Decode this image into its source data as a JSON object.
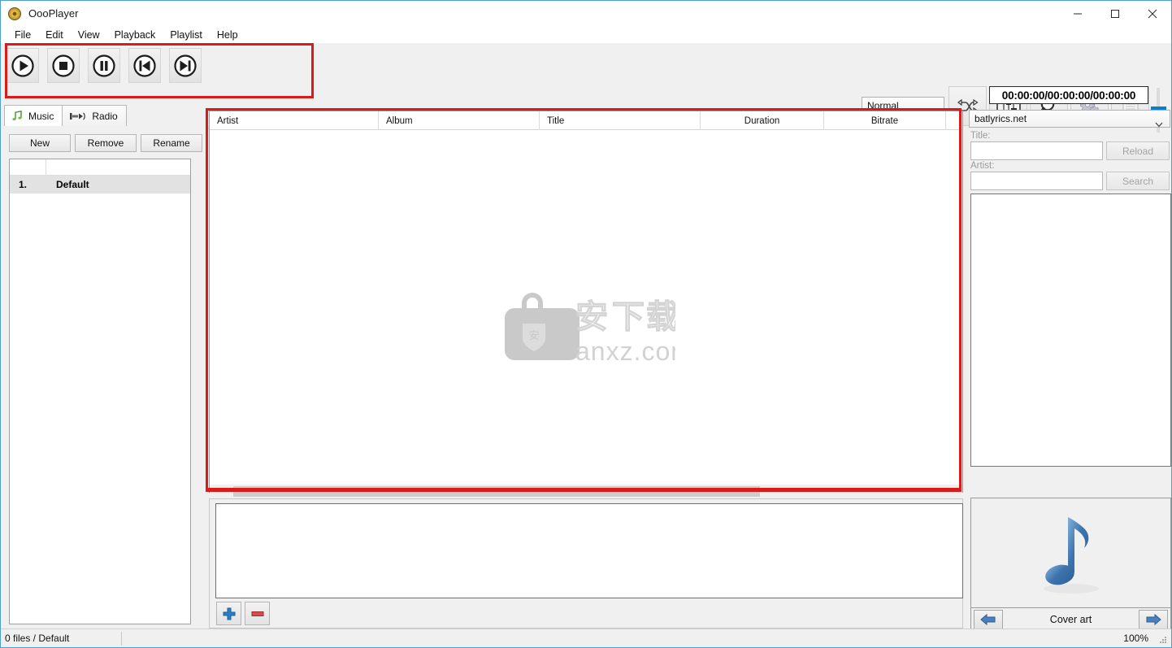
{
  "window": {
    "title": "OooPlayer",
    "app_icon": "disc-icon",
    "minimize": "minimize-icon",
    "maximize": "maximize-icon",
    "close": "close-icon"
  },
  "menubar": {
    "items": [
      {
        "label": "File"
      },
      {
        "label": "Edit"
      },
      {
        "label": "View"
      },
      {
        "label": "Playback"
      },
      {
        "label": "Playlist"
      },
      {
        "label": "Help"
      }
    ]
  },
  "toolbar": {
    "transport": [
      {
        "name": "play-button",
        "icon": "play-icon"
      },
      {
        "name": "stop-button",
        "icon": "stop-icon"
      },
      {
        "name": "pause-button",
        "icon": "pause-icon"
      },
      {
        "name": "previous-button",
        "icon": "previous-track-icon"
      },
      {
        "name": "next-button",
        "icon": "next-track-icon"
      }
    ],
    "playback_mode": "Normal",
    "tools": [
      {
        "name": "shuffle-button",
        "icon": "shuffle-icon"
      },
      {
        "name": "equalizer-button",
        "icon": "equalizer-icon"
      },
      {
        "name": "search-button",
        "icon": "magnifier-icon"
      },
      {
        "name": "settings-button",
        "icon": "gears-icon"
      },
      {
        "name": "log-button",
        "icon": "document-icon"
      }
    ],
    "seek_value": 0,
    "volume_value": 55
  },
  "time_display": "00:00:00/00:00:00/00:00:00",
  "sidebar": {
    "tabs": [
      {
        "label": "Music",
        "icon": "music-note-icon",
        "active": true
      },
      {
        "label": "Radio",
        "icon": "radio-antenna-icon",
        "active": false
      }
    ],
    "buttons": [
      {
        "label": "New"
      },
      {
        "label": "Remove"
      },
      {
        "label": "Rename"
      }
    ],
    "playlists": [
      {
        "index": "1.",
        "name": "Default"
      }
    ]
  },
  "playlist_grid": {
    "columns": [
      {
        "label": "Artist",
        "align": "left"
      },
      {
        "label": "Album",
        "align": "left"
      },
      {
        "label": "Title",
        "align": "left"
      },
      {
        "label": "Duration",
        "align": "center"
      },
      {
        "label": "Bitrate",
        "align": "center"
      }
    ],
    "rows": []
  },
  "watermark": {
    "text_cn": "安下载",
    "text_en": "anxz.com"
  },
  "lower_panel": {
    "buttons": [
      {
        "name": "add-button",
        "icon": "plus-icon"
      },
      {
        "name": "remove-button",
        "icon": "minus-icon"
      }
    ]
  },
  "lyrics_panel": {
    "source": "batlyrics.net",
    "title_label": "Title:",
    "title_value": "",
    "artist_label": "Artist:",
    "artist_value": "",
    "reload_label": "Reload",
    "search_label": "Search",
    "lyrics_text": ""
  },
  "cover_panel": {
    "label": "Cover art",
    "icon": "music-note-icon",
    "prev": "arrow-left-icon",
    "next": "arrow-right-icon"
  },
  "statusbar": {
    "left": "0 files / Default",
    "right": "100%"
  },
  "colors": {
    "accent": "#0c7ec9",
    "annotation": "#d91b19",
    "window_bg": "#f0f0f0",
    "border": "#4c9fd0"
  }
}
